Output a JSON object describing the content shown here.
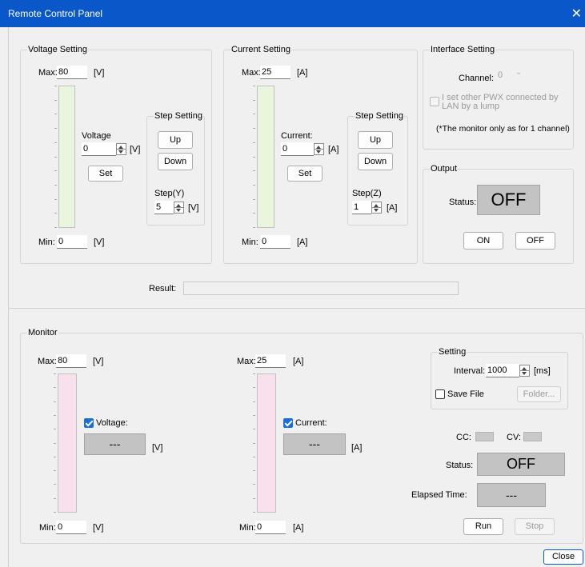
{
  "window": {
    "title": "Remote Control Panel",
    "close_glyph": "✕"
  },
  "voltage_setting": {
    "title": "Voltage Setting",
    "max_label": "Max:",
    "max_value": "80",
    "max_unit": "[V]",
    "min_label": "Min:",
    "min_value": "0",
    "min_unit": "[V]",
    "value_label": "Voltage",
    "value": "0",
    "value_unit": "[V]",
    "set_label": "Set",
    "step": {
      "title": "Step Setting",
      "up_label": "Up",
      "down_label": "Down",
      "step_label": "Step(Y)",
      "step_value": "5",
      "step_unit": "[V]"
    }
  },
  "current_setting": {
    "title": "Current Setting",
    "max_label": "Max:",
    "max_value": "25",
    "max_unit": "[A]",
    "min_label": "Min:",
    "min_value": "0",
    "min_unit": "[A]",
    "value_label": "Current:",
    "value": "0",
    "value_unit": "[A]",
    "set_label": "Set",
    "step": {
      "title": "Step Setting",
      "up_label": "Up",
      "down_label": "Down",
      "step_label": "Step(Z)",
      "step_value": "1",
      "step_unit": "[A]"
    }
  },
  "interface_setting": {
    "title": "Interface Setting",
    "channel_label": "Channel:",
    "channel_value": "0",
    "lan_checkbox_label": "I set other PWX connected by LAN by a lump",
    "note": "(*The monitor only as for 1 channel)"
  },
  "output": {
    "title": "Output",
    "status_label": "Status:",
    "status_value": "OFF",
    "on_label": "ON",
    "off_label": "OFF"
  },
  "result": {
    "label": "Result:",
    "value": ""
  },
  "monitor": {
    "title": "Monitor",
    "voltage": {
      "max_label": "Max:",
      "max_value": "80",
      "max_unit": "[V]",
      "min_label": "Min:",
      "min_value": "0",
      "min_unit": "[V]",
      "check_label": "Voltage:",
      "checked": true,
      "reading": "---",
      "unit": "[V]"
    },
    "current": {
      "max_label": "Max:",
      "max_value": "25",
      "max_unit": "[A]",
      "min_label": "Min:",
      "min_value": "0",
      "min_unit": "[A]",
      "check_label": "Current:",
      "checked": true,
      "reading": "---",
      "unit": "[A]"
    },
    "setting": {
      "title": "Setting",
      "interval_label": "Interval:",
      "interval_value": "1000",
      "interval_unit": "[ms]",
      "save_file_label": "Save File",
      "folder_label": "Folder..."
    },
    "cc_label": "CC:",
    "cv_label": "CV:",
    "status_label": "Status:",
    "status_value": "OFF",
    "elapsed_label": "Elapsed Time:",
    "elapsed_value": "---",
    "run_label": "Run",
    "stop_label": "Stop"
  },
  "close_label": "Close",
  "colors": {
    "titlebar": "#0a57c9",
    "voltage_bar_fill": "#e9f5dc",
    "monitor_bar_fill": "#f8e1ec",
    "display_bg": "#c3c3c3",
    "checkbox_checked": "#1a6ed8"
  }
}
